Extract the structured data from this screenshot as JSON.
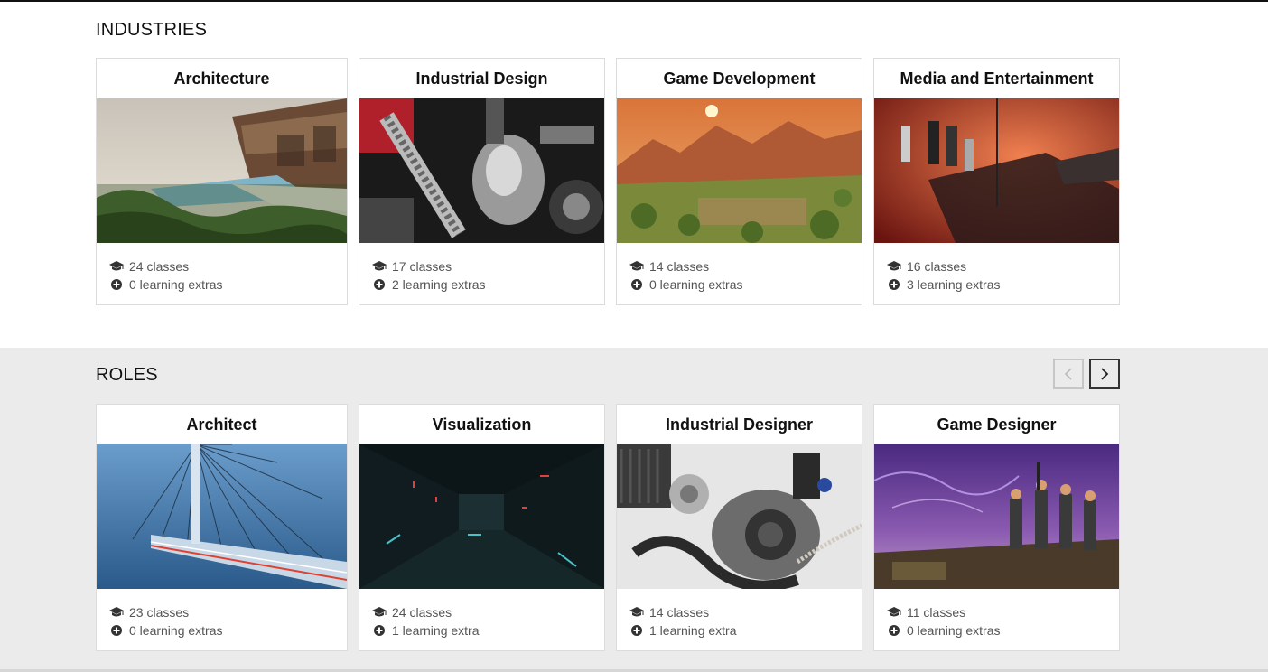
{
  "industries": {
    "title": "INDUSTRIES",
    "cards": [
      {
        "title": "Architecture",
        "classes": "24 classes",
        "extras": "0 learning extras"
      },
      {
        "title": "Industrial Design",
        "classes": "17 classes",
        "extras": "2 learning extras"
      },
      {
        "title": "Game Development",
        "classes": "14 classes",
        "extras": "0 learning extras"
      },
      {
        "title": "Media and Entertainment",
        "classes": "16 classes",
        "extras": "3 learning extras"
      }
    ]
  },
  "roles": {
    "title": "ROLES",
    "cards": [
      {
        "title": "Architect",
        "classes": "23 classes",
        "extras": "0 learning extras"
      },
      {
        "title": "Visualization",
        "classes": "24 classes",
        "extras": "1 learning extra"
      },
      {
        "title": "Industrial Designer",
        "classes": "14 classes",
        "extras": "1 learning extra"
      },
      {
        "title": "Game Designer",
        "classes": "11 classes",
        "extras": "0 learning extras"
      }
    ]
  },
  "icons": {
    "classes": "graduation-cap-icon",
    "extras": "plus-circle-icon",
    "prev": "chevron-left-icon",
    "next": "chevron-right-icon"
  },
  "colors": {
    "section_bg_alt": "#ebebeb",
    "card_border": "#dcdcdc",
    "meta_text": "#555555"
  }
}
